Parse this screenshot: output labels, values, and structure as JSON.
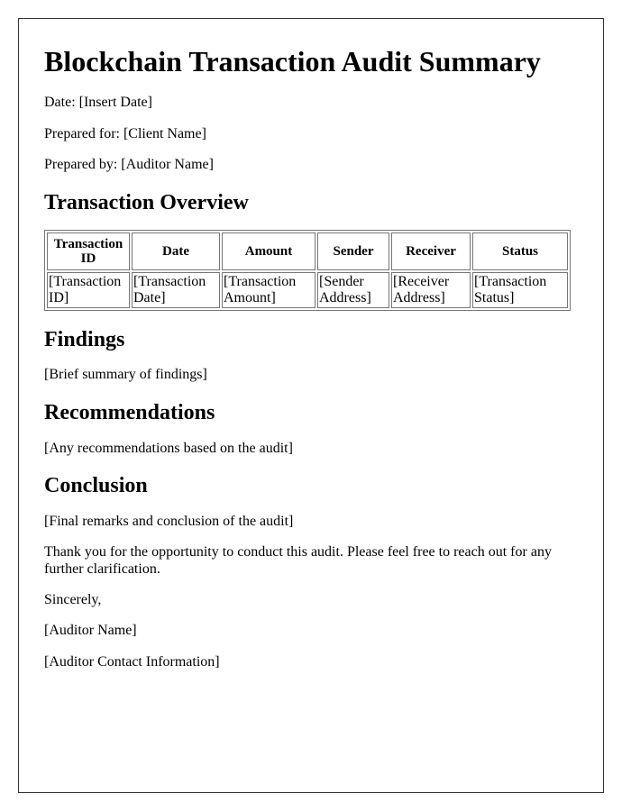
{
  "title": "Blockchain Transaction Audit Summary",
  "meta": {
    "date": "Date: [Insert Date]",
    "prepared_for": "Prepared for: [Client Name]",
    "prepared_by": "Prepared by: [Auditor Name]"
  },
  "overview": {
    "heading": "Transaction Overview",
    "columns": [
      "Transaction ID",
      "Date",
      "Amount",
      "Sender",
      "Receiver",
      "Status"
    ],
    "rows": [
      [
        "[Transaction ID]",
        "[Transaction Date]",
        "[Transaction Amount]",
        "[Sender Address]",
        "[Receiver Address]",
        "[Transaction Status]"
      ]
    ]
  },
  "findings": {
    "heading": "Findings",
    "text": "[Brief summary of findings]"
  },
  "recommendations": {
    "heading": "Recommendations",
    "text": "[Any recommendations based on the audit]"
  },
  "conclusion": {
    "heading": "Conclusion",
    "text": "[Final remarks and conclusion of the audit]",
    "thanks": "Thank you for the opportunity to conduct this audit. Please feel free to reach out for any further clarification.",
    "closing": "Sincerely,",
    "signer": "[Auditor Name]",
    "contact": "[Auditor Contact Information]"
  }
}
